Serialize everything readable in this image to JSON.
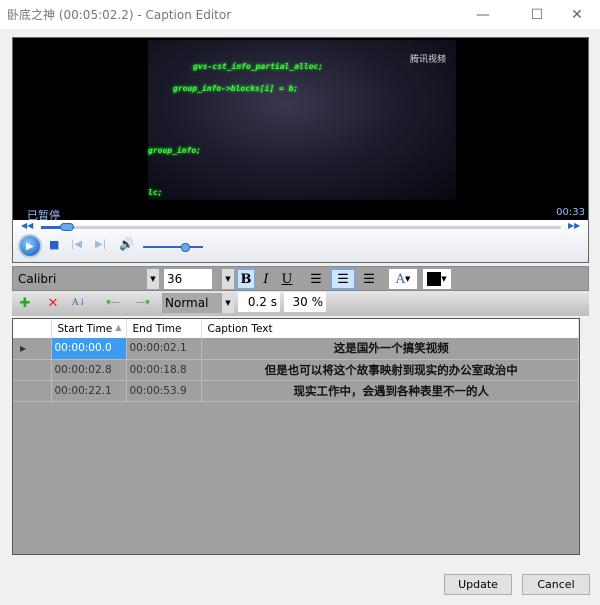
{
  "window": {
    "title": "卧底之神 (00:05:02.2) - Caption Editor",
    "minimize": "—",
    "maximize": "☐",
    "close": "✕"
  },
  "player": {
    "status": "已暂停",
    "time": "00:33",
    "video_logo": "腾讯视频",
    "video_code": [
      "gvs-cst_info_partial_alloc;",
      "group_info->blocks[i] = b;",
      "group_info;",
      "lc;"
    ],
    "seek_progress": 0.05,
    "volume": 0.7
  },
  "format_toolbar": {
    "font": "Calibri",
    "size": "36",
    "bold": "B",
    "italic": "I",
    "underline": "U",
    "font_color_glyph": "A"
  },
  "edit_toolbar": {
    "style": "Normal",
    "duration": "0.2 s",
    "opacity": "30 %"
  },
  "grid": {
    "columns": [
      "Start Time",
      "End Time",
      "Caption Text"
    ],
    "rows": [
      {
        "start": "00:00:00.0",
        "end": "00:00:02.1",
        "text": "这是国外一个搞笑视频"
      },
      {
        "start": "00:00:02.8",
        "end": "00:00:18.8",
        "text": "但是也可以将这个故事映射到现实的办公室政治中"
      },
      {
        "start": "00:00:22.1",
        "end": "00:00:53.9",
        "text": "现实工作中，会遇到各种表里不一的人"
      }
    ]
  },
  "buttons": {
    "update": "Update",
    "cancel": "Cancel"
  }
}
